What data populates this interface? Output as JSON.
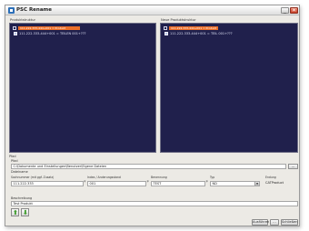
{
  "window": {
    "title": "PSC Rename"
  },
  "panels": {
    "left": {
      "label": "Produktstruktur",
      "highlight_text": "111.222.333-444+001 = Produkt",
      "child_text": "111.222.333-444+001 = TEILEN 001+???"
    },
    "right": {
      "label": "Neue Produktstruktur",
      "highlight_text": "111.222.333-444+001 = Produkt",
      "child_text": "111.222.333-444+001 = TEIL 001+???"
    }
  },
  "form": {
    "path_group_label": "Pfad",
    "path_label": "Pfad",
    "path_value": "C:\\Dokumente und Einstellungen\\Benutzer\\Eigene Dateien",
    "browse_label": "...",
    "filename_section_label": "Dateiname",
    "columns": {
      "part_number": "Sachnummer (mit ggf. Zusatz)",
      "index": "Index / Änderungsstand",
      "benennung": "Benennung",
      "typ": "Typ",
      "extension": "Endung"
    },
    "values": {
      "part_number": "111.222.333",
      "index": "001",
      "benennung": "TEST",
      "typ": "ND",
      "extension": "CATProduct"
    },
    "required_marker": "*",
    "dropdown_arrow": "▼",
    "description_label": "Beschreibung",
    "description_value": "Test Produkt"
  },
  "buttons": {
    "move_up_icon": "arrow-up-icon",
    "move_down_icon": "arrow-down-icon",
    "up_glyph": "⬆",
    "down_glyph": "⬇",
    "ok_label": "Ausführen",
    "x_label": "...",
    "cancel_label": "Schließen",
    "minimize_glyph": "_",
    "close_glyph": "✕"
  },
  "colors": {
    "panel_background": "#20204c",
    "selection": "#ec6f2a",
    "arrow_green": "#3b9a27",
    "close_red": "#c5391f"
  }
}
